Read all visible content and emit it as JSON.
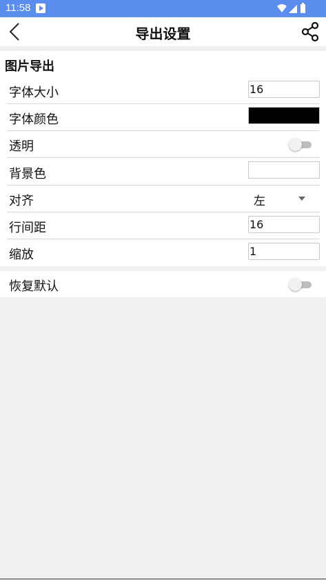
{
  "status_bar": {
    "time": "11:58",
    "app_icon": "play-badge-icon",
    "icons": [
      "wifi-icon",
      "signal-icon",
      "battery-icon"
    ]
  },
  "app_bar": {
    "title": "导出设置",
    "back_icon": "chevron-left-icon",
    "share_icon": "share-icon"
  },
  "section": {
    "title": "图片导出",
    "rows": {
      "font_size": {
        "label": "字体大小",
        "value": "16"
      },
      "font_color": {
        "label": "字体颜色",
        "color": "#000000"
      },
      "transparent": {
        "label": "透明",
        "on": false
      },
      "bg_color": {
        "label": "背景色",
        "color": "#ffffff"
      },
      "align": {
        "label": "对齐",
        "value": "左"
      },
      "line_spacing": {
        "label": "行间距",
        "value": "16"
      },
      "scale": {
        "label": "缩放",
        "value": "1"
      }
    }
  },
  "reset": {
    "label": "恢复默认",
    "on": false
  },
  "colors": {
    "status_bar": "#5b8def",
    "background": "#f0f0f0",
    "toggle_track": "#bdbdbd"
  }
}
